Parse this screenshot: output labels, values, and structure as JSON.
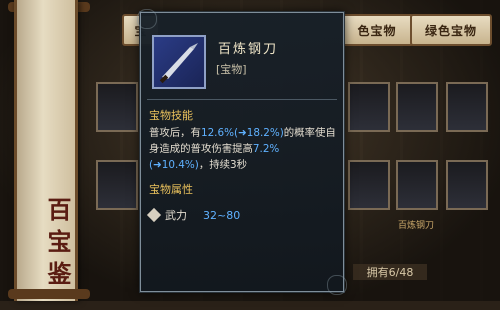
{
  "side_scroll": {
    "title": "百宝鉴"
  },
  "tabs": [
    "宝",
    "色宝物",
    "绿色宝物"
  ],
  "slot_labels": [
    "百炼钢刀"
  ],
  "owned_count": "拥有6/48",
  "tooltip": {
    "name": "百炼钢刀",
    "type": "[宝物]",
    "skill_title": "宝物技能",
    "skill_desc": {
      "pre": "普攻后，有",
      "chance": "12.6%(➜18.2%)",
      "mid": "的概率使自身造成的普攻伤害提高",
      "boost": "7.2%(➜10.4%)",
      "post": "，持续3秒"
    },
    "attr_title": "宝物属性",
    "attr_name": "武力",
    "attr_value": "32~80"
  }
}
